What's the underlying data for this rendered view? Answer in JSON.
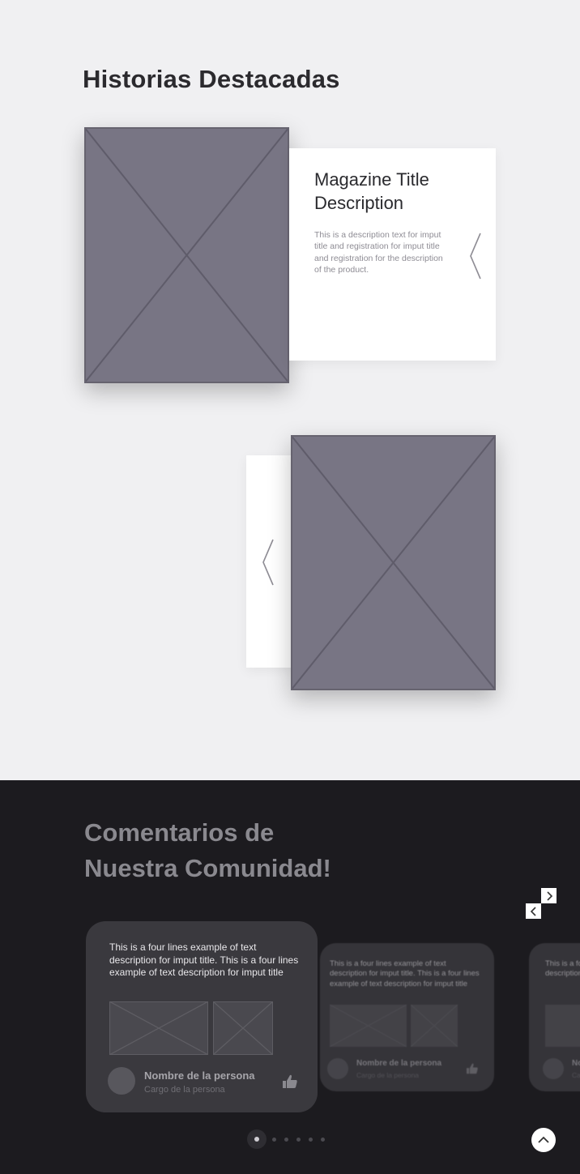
{
  "featured": {
    "heading": "Historias Destacadas",
    "story1": {
      "title": "Magazine Title Description",
      "description": "This is a description text for imput title and registration for imput title and registration for the description of the product."
    },
    "next_icon": "chevron-right-icon",
    "prev_icon": "chevron-left-icon"
  },
  "community": {
    "heading_line1": "Comentarios de",
    "heading_line2": "Nuestra Comunidad!",
    "cards": [
      {
        "text": "This is a four lines example of text description for imput title. This is a four lines example of text description for imput title",
        "name": "Nombre de la persona",
        "role": "Cargo de la persona"
      },
      {
        "text": "This is a four lines example of text description for imput title. This is a four lines example of text description for imput title",
        "name": "Nombre de la persona",
        "role": "Cargo de la persona"
      },
      {
        "text": "This is a four lines example of text description for imput title",
        "name": "Nombre de la persona",
        "role": "Cargo de la persona"
      }
    ],
    "pagination": {
      "total": 6,
      "active": 1
    },
    "like_icon": "thumbs-up-icon",
    "scroll_top_icon": "chevron-up-icon"
  },
  "colors": {
    "light_bg": "#f0f0f2",
    "dark_bg": "#1c1b1f",
    "placeholder": "#787584",
    "card_dark": "#3a393e"
  }
}
